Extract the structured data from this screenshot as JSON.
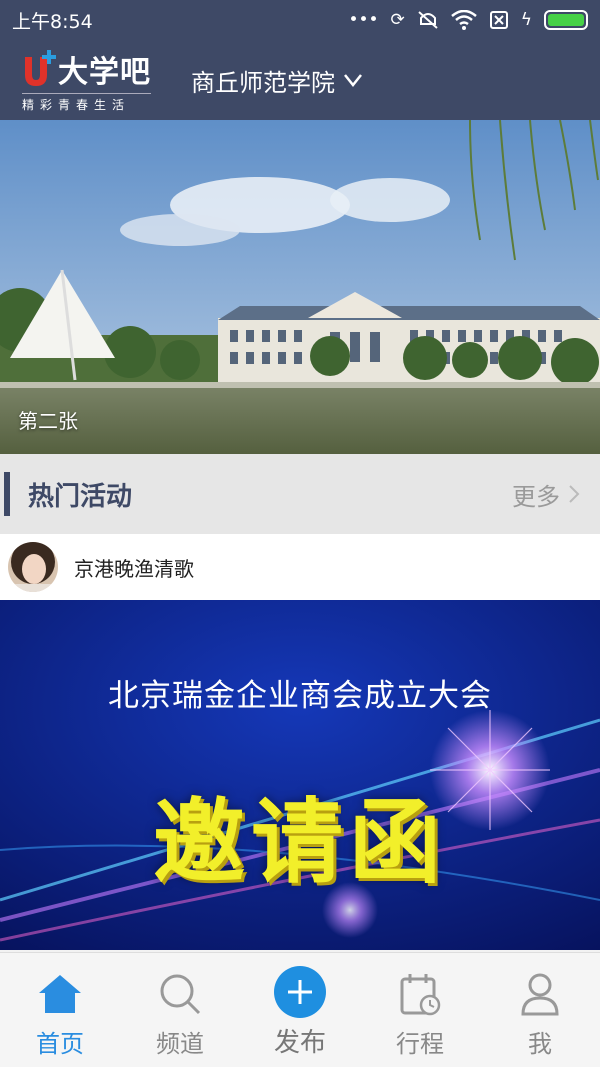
{
  "status_bar": {
    "time": "上午8:54",
    "icons": [
      "more-icon",
      "sync-icon",
      "mute-icon",
      "wifi-icon",
      "sim-icon",
      "charging-icon",
      "battery-icon"
    ],
    "battery_level": 1.0
  },
  "header": {
    "logo_name": "大学吧",
    "logo_tagline": "精彩青春生活",
    "school": "商丘师范学院",
    "dropdown_icon": "chevron-down-icon"
  },
  "banner": {
    "caption": "第二张"
  },
  "hot_section": {
    "title": "热门活动",
    "more_label": "更多"
  },
  "activity": {
    "user_name": "京港晚渔清歌",
    "poster_title": "北京瑞金企业商会成立大会",
    "poster_main": "邀请函"
  },
  "nav": {
    "items": [
      {
        "label": "首页",
        "icon": "home-icon"
      },
      {
        "label": "频道",
        "icon": "search-icon"
      },
      {
        "label": "发布",
        "icon": "plus-icon"
      },
      {
        "label": "行程",
        "icon": "calendar-icon"
      },
      {
        "label": "我",
        "icon": "user-icon"
      }
    ]
  },
  "colors": {
    "header_bg": "#3e4966",
    "accent": "#2a8de0",
    "poster_text": "#f2ef2a"
  }
}
